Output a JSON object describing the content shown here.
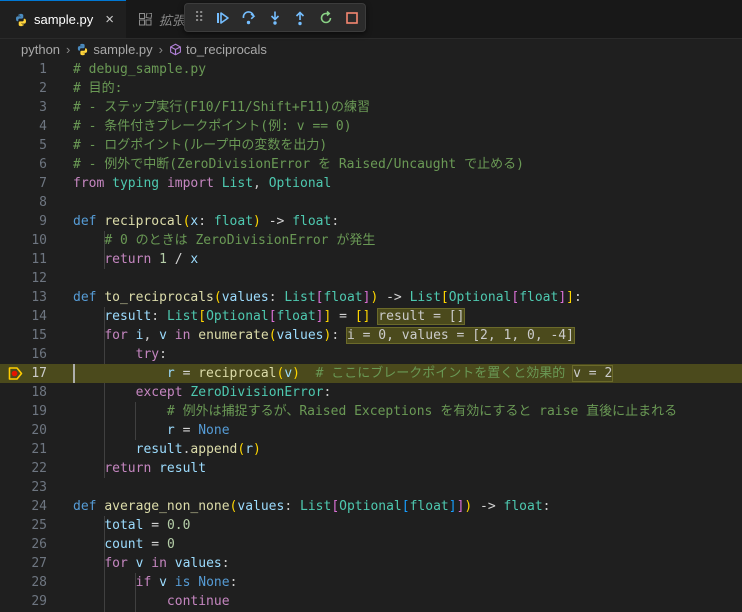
{
  "tabs": [
    {
      "label": "sample.py",
      "close": "×"
    },
    {
      "label": "拡張"
    }
  ],
  "debug_toolbar": {
    "grip": "⠿"
  },
  "breadcrumb": {
    "folder": "python",
    "file": "sample.py",
    "symbol": "to_reciprocals",
    "sep": "›"
  },
  "editor": {
    "current_line": 17,
    "line_numbers": [
      "1",
      "2",
      "3",
      "4",
      "5",
      "6",
      "7",
      "8",
      "9",
      "10",
      "11",
      "12",
      "13",
      "14",
      "15",
      "16",
      "17",
      "18",
      "19",
      "20",
      "21",
      "22",
      "23",
      "24",
      "25",
      "26",
      "27",
      "28",
      "29"
    ],
    "inline_values": {
      "line14": "result = []",
      "line16": "i = 0, values = [2, 1, 0, -4]",
      "line17": "v = 2"
    },
    "comments": {
      "l1": "# debug_sample.py",
      "l2": "# 目的:",
      "l3": "# - ステップ実行(F10/F11/Shift+F11)の練習",
      "l4": "# - 条件付きブレークポイント(例: v == 0)",
      "l5": "# - ログポイント(ループ中の変数を出力)",
      "l6": "# - 例外で中断(ZeroDivisionError を Raised/Uncaught で止める)",
      "l10": "# 0 のときは ZeroDivisionError が発生",
      "l17": "# ここにブレークポイントを置くと効果的",
      "l19": "# 例外は捕捉するが、Raised Exceptions を有効にすると raise 直後に止まれる"
    }
  }
}
